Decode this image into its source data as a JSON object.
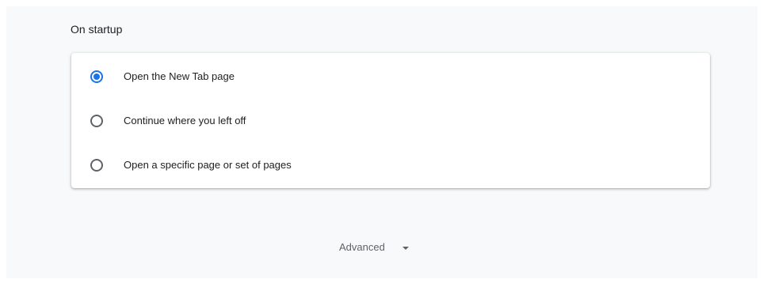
{
  "startup": {
    "title": "On startup",
    "options": [
      {
        "label": "Open the New Tab page",
        "checked": true
      },
      {
        "label": "Continue where you left off",
        "checked": false
      },
      {
        "label": "Open a specific page or set of pages",
        "checked": false
      }
    ]
  },
  "advanced": {
    "label": "Advanced",
    "icon": "arrow-drop-down-icon"
  },
  "colors": {
    "accent": "#1a73e8",
    "background": "#f8f9fa",
    "card": "#ffffff"
  }
}
